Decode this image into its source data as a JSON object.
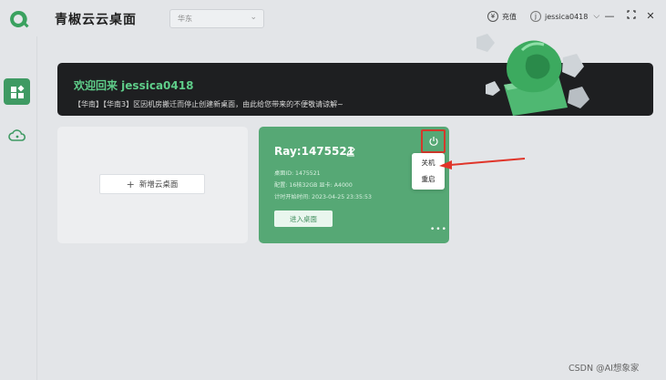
{
  "app": {
    "title": "青椒云云桌面"
  },
  "region": {
    "selected": "华东"
  },
  "header": {
    "recharge_label": "充值",
    "username": "jessica0418"
  },
  "banner": {
    "welcome": "欢迎回来 jessica0418",
    "notice": "【华南】【华南3】区因机房搬迁而停止创建新桌面，由此给您带来的不便敬请谅解~"
  },
  "add_card": {
    "label": "新增云桌面"
  },
  "desktop": {
    "name": "Ray:1475521",
    "id_line": "桌面ID: 1475521",
    "config_line": "配置: 16核32GB  显卡: A4000",
    "start_line": "计时开始时间: 2023-04-25 23:35:53",
    "enter_label": "进入桌面"
  },
  "power_menu": {
    "items": [
      "关机",
      "重启"
    ]
  },
  "watermark": "CSDN @AI想象家",
  "colors": {
    "accent": "#3f9a63",
    "card": "#56a875",
    "highlight": "#d23a2c"
  },
  "icons": {
    "logo": "q-logo-icon",
    "recharge": "coin-icon",
    "user": "user-avatar-icon",
    "minimize": "minimize-icon",
    "maximize": "maximize-icon",
    "close": "close-icon",
    "nav_desktop": "desktop-grid-icon",
    "nav_cloud": "cloud-icon",
    "edit": "pencil-icon",
    "power": "power-icon",
    "more": "more-dots-icon"
  }
}
